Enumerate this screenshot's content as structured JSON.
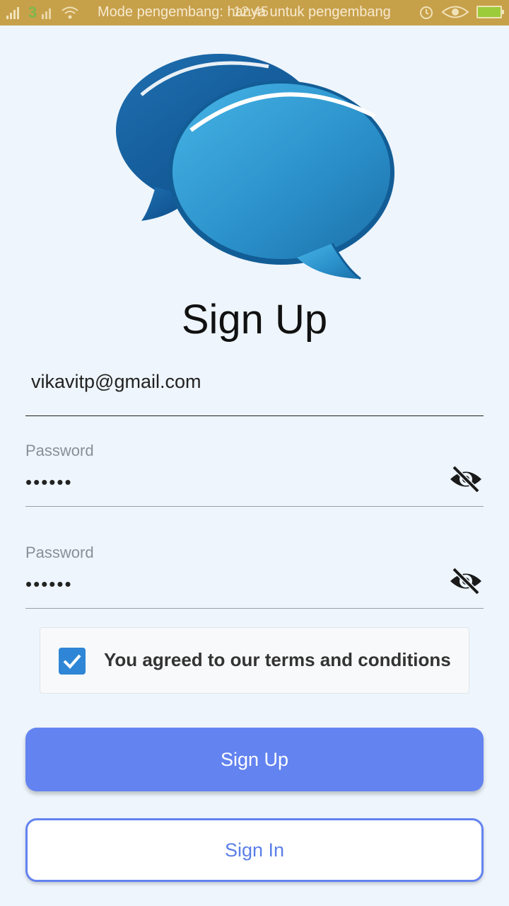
{
  "status_bar": {
    "carrier": "3",
    "notification_text": "Mode pengembang: hanya untuk pengembang",
    "time": "12.45",
    "colors": {
      "background": "#c7a04a"
    }
  },
  "logo": {
    "icon": "chat-bubbles-icon"
  },
  "title": "Sign Up",
  "email": {
    "value": "vikavitp@gmail.com"
  },
  "password": {
    "label": "Password",
    "value": "••••••",
    "toggle_icon": "eye-off-icon"
  },
  "confirm_password": {
    "label": "Password",
    "value": "••••••",
    "toggle_icon": "eye-off-icon"
  },
  "terms": {
    "checked": true,
    "label": "You agreed to our terms and conditions"
  },
  "buttons": {
    "sign_up": "Sign Up",
    "sign_in": "Sign In"
  },
  "colors": {
    "primary": "#6383f0",
    "background": "#eef5fc",
    "checkbox": "#2f86d6"
  }
}
